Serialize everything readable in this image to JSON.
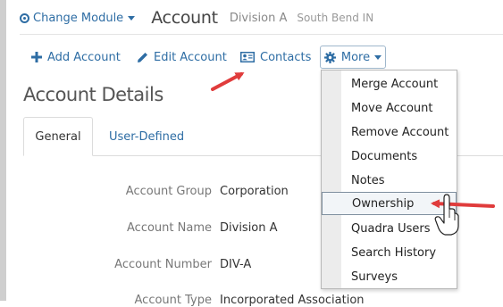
{
  "header": {
    "change_module": "Change Module",
    "title": "Account",
    "account_name": "Division A",
    "location": "South Bend IN"
  },
  "toolbar": {
    "add_account": "Add Account",
    "edit_account": "Edit Account",
    "contacts": "Contacts",
    "more": "More"
  },
  "section": {
    "title": "Account Details"
  },
  "tabs": [
    {
      "label": "General"
    },
    {
      "label": "User-Defined"
    }
  ],
  "fields": [
    {
      "label": "Account Group",
      "value": "Corporation"
    },
    {
      "label": "Account Name",
      "value": "Division A"
    },
    {
      "label": "Account Number",
      "value": "DIV-A"
    },
    {
      "label": "Account Type",
      "value": "Incorporated Association"
    }
  ],
  "more_menu": {
    "items": [
      {
        "label": "Merge Account"
      },
      {
        "label": "Move Account"
      },
      {
        "label": "Remove Account"
      },
      {
        "label": "Documents"
      },
      {
        "label": "Notes"
      },
      {
        "label": "Ownership"
      },
      {
        "label": "Quadra Users"
      },
      {
        "label": "Search History"
      },
      {
        "label": "Surveys"
      }
    ]
  },
  "colors": {
    "link": "#2e6da4",
    "annotation_arrow": "#e03c3c",
    "menu_gutter": "#ececec"
  }
}
